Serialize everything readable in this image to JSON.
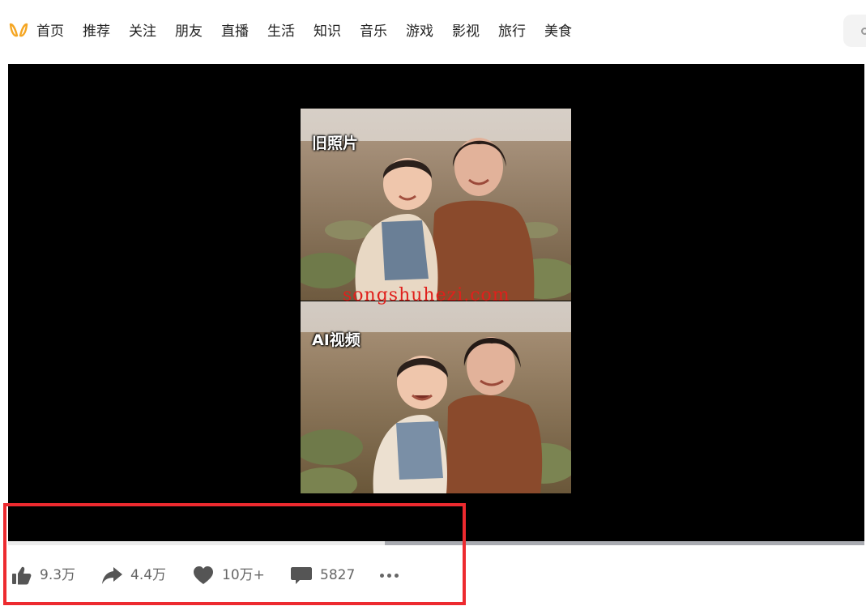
{
  "nav": {
    "logo_icon": "douyin-butterfly-icon",
    "logo_color": "#f5a623",
    "items": [
      {
        "label": "首页"
      },
      {
        "label": "推荐"
      },
      {
        "label": "关注"
      },
      {
        "label": "朋友"
      },
      {
        "label": "直播"
      },
      {
        "label": "生活"
      },
      {
        "label": "知识"
      },
      {
        "label": "音乐"
      },
      {
        "label": "游戏"
      },
      {
        "label": "影视"
      },
      {
        "label": "旅行"
      },
      {
        "label": "美食"
      }
    ]
  },
  "video": {
    "top_label": "旧照片",
    "bottom_label": "AI视频",
    "watermark": "songshuhezi.com",
    "progress_buffered_fraction": 0.56
  },
  "actions": {
    "like": {
      "icon": "thumbs-up-icon",
      "count": "9.3万"
    },
    "share": {
      "icon": "share-arrow-icon",
      "count": "4.4万"
    },
    "favorite": {
      "icon": "heart-icon",
      "count": "10万+"
    },
    "comment": {
      "icon": "comment-bubble-icon",
      "count": "5827"
    },
    "more": {
      "icon": "more-dots-icon"
    }
  },
  "colors": {
    "highlight": "#ed2a2f",
    "player_bg": "#000000",
    "watermark": "#e0201c"
  }
}
